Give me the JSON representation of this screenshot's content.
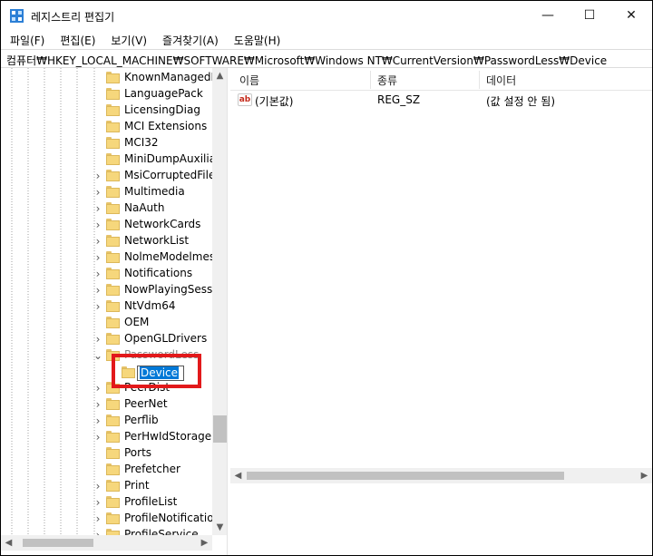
{
  "window": {
    "title": "레지스트리 편집기",
    "controls": {
      "minimize": "—",
      "maximize": "☐",
      "close": "✕"
    }
  },
  "menu": [
    "파일(F)",
    "편집(E)",
    "보기(V)",
    "즐겨찾기(A)",
    "도움말(H)"
  ],
  "address": "컴퓨터₩HKEY_LOCAL_MACHINE₩SOFTWARE₩Microsoft₩Windows NT₩CurrentVersion₩PasswordLess₩Device",
  "tree": {
    "items": [
      {
        "label": "KnownManagedD",
        "expander": ""
      },
      {
        "label": "LanguagePack",
        "expander": ""
      },
      {
        "label": "LicensingDiag",
        "expander": ""
      },
      {
        "label": "MCI Extensions",
        "expander": ""
      },
      {
        "label": "MCI32",
        "expander": ""
      },
      {
        "label": "MiniDumpAuxiliar",
        "expander": ""
      },
      {
        "label": "MsiCorruptedFileR",
        "expander": ">"
      },
      {
        "label": "Multimedia",
        "expander": ">"
      },
      {
        "label": "NaAuth",
        "expander": ">"
      },
      {
        "label": "NetworkCards",
        "expander": ">"
      },
      {
        "label": "NetworkList",
        "expander": ">"
      },
      {
        "label": "NolmeModelmes",
        "expander": ">"
      },
      {
        "label": "Notifications",
        "expander": ">"
      },
      {
        "label": "NowPlayingSessio",
        "expander": ">"
      },
      {
        "label": "NtVdm64",
        "expander": ">"
      },
      {
        "label": "OEM",
        "expander": ""
      },
      {
        "label": "OpenGLDrivers",
        "expander": ">"
      },
      {
        "label": "PasswordLess",
        "expander": "v"
      },
      {
        "label": "PeerDist",
        "expander": ">"
      },
      {
        "label": "PeerNet",
        "expander": ">"
      },
      {
        "label": "Perflib",
        "expander": ">"
      },
      {
        "label": "PerHwIdStorage",
        "expander": ">"
      },
      {
        "label": "Ports",
        "expander": ""
      },
      {
        "label": "Prefetcher",
        "expander": ""
      },
      {
        "label": "Print",
        "expander": ">"
      },
      {
        "label": "ProfileList",
        "expander": ">"
      },
      {
        "label": "ProfileNotification",
        "expander": ">"
      },
      {
        "label": "ProfileService",
        "expander": ">"
      }
    ],
    "editing_value": "Device"
  },
  "list": {
    "headers": [
      "이름",
      "종류",
      "데이터"
    ],
    "rows": [
      {
        "icon": "ab",
        "name": "(기본값)",
        "type": "REG_SZ",
        "data": "(값 설정 안 됨)"
      }
    ]
  },
  "icons": {
    "app": "registry-editor-icon",
    "folder": "folder-icon",
    "value": "string-value-icon"
  },
  "colors": {
    "selection": "#0078d7",
    "highlight_border": "#e2191b",
    "folder": "#f6d77c"
  }
}
